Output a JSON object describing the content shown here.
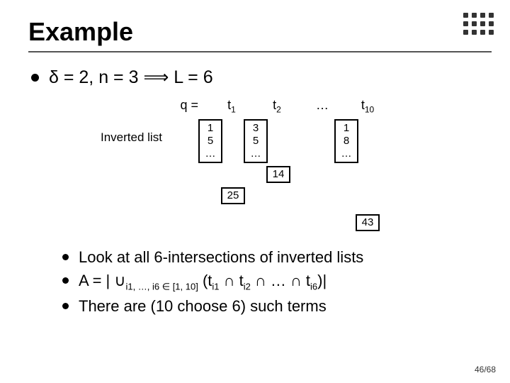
{
  "title": "Example",
  "line1": {
    "delta": "δ = 2, ",
    "n": "n = 3 ",
    "arrow": "⟹",
    "L": " L = 6"
  },
  "q": {
    "label": "q =",
    "t1": "t",
    "t1sub": "1",
    "t2": "t",
    "t2sub": "2",
    "dots": "…",
    "t10": "t",
    "t10sub": "10"
  },
  "inv_label": "Inverted list",
  "boxes": {
    "b1": "1\n5\n…",
    "b2": "3\n5\n…",
    "b3": "1\n8\n…"
  },
  "extra": {
    "b14": "14",
    "b25": "25",
    "b43": "43"
  },
  "bottom": {
    "l1": "Look at all 6-intersections of inverted lists",
    "l2_pre": "A = | ∪",
    "l2_sub": "i1, …, i6 ∈ [1, 10]",
    "l2_mid": " (t",
    "l2_s1": "i1",
    "l2_cap": " ∩ t",
    "l2_s2": "i2",
    "l2_cap2": " ∩ … ∩ t",
    "l2_s6": "i6",
    "l2_end": ")|",
    "l3": "There are (10 choose 6) such terms"
  },
  "page": "46/68"
}
